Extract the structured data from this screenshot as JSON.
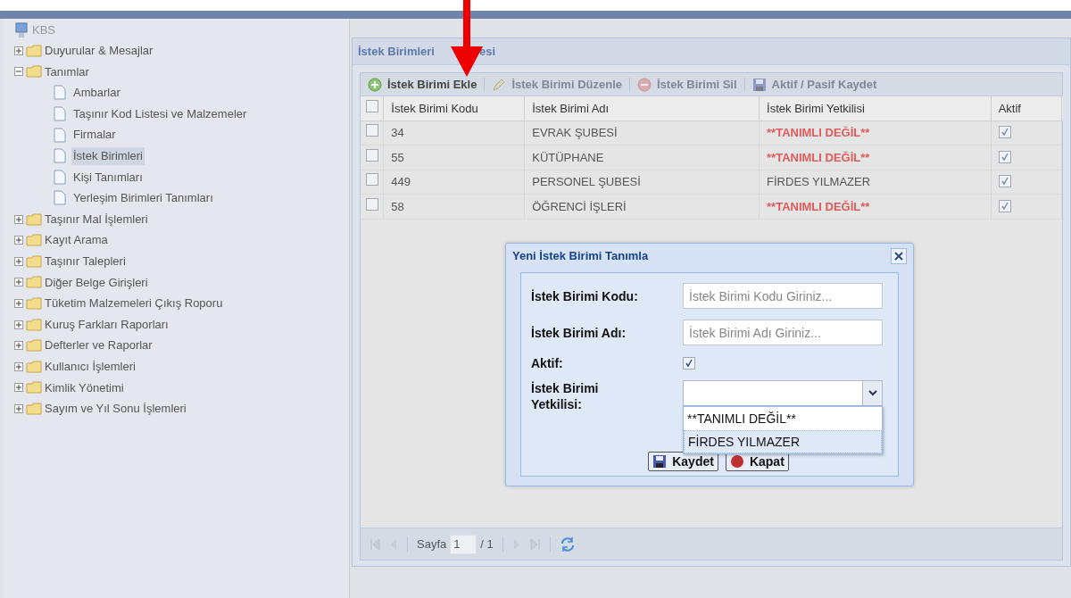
{
  "tree": {
    "root": "KBS",
    "items": [
      {
        "label": "Duyurular & Mesajlar",
        "expanded": false
      },
      {
        "label": "Tanımlar",
        "expanded": true,
        "children": [
          {
            "label": "Ambarlar",
            "selected": false
          },
          {
            "label": "Taşınır Kod Listesi ve Malzemeler",
            "selected": false
          },
          {
            "label": "Firmalar",
            "selected": false
          },
          {
            "label": "İstek Birimleri",
            "selected": true
          },
          {
            "label": "Kişi Tanımları",
            "selected": false
          },
          {
            "label": "Yerleşim Birimleri Tanımları",
            "selected": false
          }
        ]
      },
      {
        "label": "Taşınır Mal İşlemleri",
        "expanded": false
      },
      {
        "label": "Kayıt Arama",
        "expanded": false
      },
      {
        "label": "Taşınır Talepleri",
        "expanded": false
      },
      {
        "label": "Diğer Belge Girişleri",
        "expanded": false
      },
      {
        "label": "Tüketim Malzemeleri Çıkış Roporu",
        "expanded": false
      },
      {
        "label": "Kuruş Farkları Raporları",
        "expanded": false
      },
      {
        "label": "Defterler ve Raporlar",
        "expanded": false
      },
      {
        "label": "Kullanıcı İşlemleri",
        "expanded": false
      },
      {
        "label": "Kimlik Yönetimi",
        "expanded": false
      },
      {
        "label": "Sayım ve Yıl Sonu İşlemleri",
        "expanded": false
      }
    ]
  },
  "panel": {
    "title_parts": [
      "İstek Birimleri",
      "esi"
    ],
    "toolbar": [
      {
        "kind": "add",
        "label": "İstek Birimi Ekle",
        "disabled": false
      },
      {
        "kind": "edit",
        "label": "İstek Birimi Düzenle",
        "disabled": true
      },
      {
        "kind": "delete",
        "label": "İstek Birimi Sil",
        "disabled": true
      },
      {
        "kind": "save",
        "label": "Aktif / Pasif Kaydet",
        "disabled": true
      }
    ],
    "table": {
      "header_checked": false,
      "columns": [
        "İstek Birimi Kodu",
        "İstek Birimi Adı",
        "İstek Birimi Yetkilisi",
        "Aktif"
      ],
      "rows": [
        {
          "checked": false,
          "code": "34",
          "name": "EVRAK ŞUBESİ",
          "officer": "**TANIMLI DEĞİL**",
          "unassigned": true,
          "active": true
        },
        {
          "checked": false,
          "code": "55",
          "name": "KÜTÜPHANE",
          "officer": "**TANIMLI DEĞİL**",
          "unassigned": true,
          "active": true
        },
        {
          "checked": false,
          "code": "449",
          "name": "PERSONEL ŞUBESİ",
          "officer": "FİRDES YILMAZER",
          "unassigned": false,
          "active": true
        },
        {
          "checked": false,
          "code": "58",
          "name": "ÖĞRENCİ İŞLERİ",
          "officer": "**TANIMLI DEĞİL**",
          "unassigned": true,
          "active": true
        }
      ]
    },
    "pager": {
      "label": "Sayfa",
      "page": "1",
      "total": "/ 1"
    }
  },
  "dialog": {
    "title": "Yeni İstek Birimi Tanımla",
    "fields": [
      {
        "kind": "text",
        "label": "İstek Birimi Kodu:",
        "placeholder": "İstek Birimi Kodu Giriniz..."
      },
      {
        "kind": "text",
        "label": "İstek Birimi Adı:",
        "placeholder": "İstek Birimi Adı Giriniz..."
      },
      {
        "kind": "checkbox",
        "label": "Aktif:",
        "checked": true
      },
      {
        "kind": "select",
        "label": "İstek Birimi Yetkilisi:",
        "open": true,
        "options": [
          {
            "label": "**TANIMLI DEĞİL**",
            "selected": false
          },
          {
            "label": "FİRDES YILMAZER",
            "selected": true
          }
        ]
      }
    ],
    "buttons": [
      {
        "kind": "save",
        "label": "Kaydet"
      },
      {
        "kind": "close",
        "label": "Kapat"
      }
    ]
  }
}
